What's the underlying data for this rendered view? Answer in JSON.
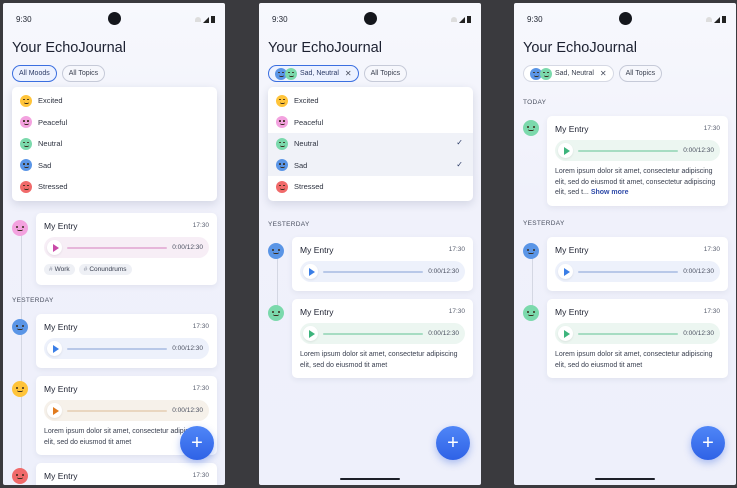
{
  "status_time": "9:30",
  "app_title": "Your EchoJournal",
  "filters": {
    "all_moods": "All Moods",
    "all_topics": "All Topics",
    "selected_moods": "Sad, Neutral",
    "clear_symbol": "✕"
  },
  "moods": [
    {
      "label": "Excited",
      "icon": "excited-face-icon",
      "color": "#ffc43a"
    },
    {
      "label": "Peaceful",
      "icon": "peaceful-face-icon",
      "color": "#f3a2df"
    },
    {
      "label": "Neutral",
      "icon": "neutral-face-icon",
      "color": "#7bd9ac"
    },
    {
      "label": "Sad",
      "icon": "sad-face-icon",
      "color": "#5a95e6"
    },
    {
      "label": "Stressed",
      "icon": "stressed-face-icon",
      "color": "#f06a6a"
    }
  ],
  "sections": {
    "today": "TODAY",
    "yesterday": "YESTERDAY"
  },
  "entry": {
    "title": "My Entry",
    "time": "17:30",
    "duration": "0:00/12:30",
    "text": "Lorem ipsum dolor sit amet, consectetur adipiscing elit, sed do eiusmod tit amet",
    "text_cut1": "Lorem ipsum dolor sit amet, consectetur adipiscing elit, sed do eiusmod tit amet",
    "text_cut3": "Lorem ipsum dolor sit amet, consectetur adipiscing elit, sed do eiusmod tit amet, consectetur adipiscing elit, sed t...",
    "show_more": "Show more"
  },
  "tags": [
    "Work",
    "Conundrums"
  ],
  "tag_prefix": "#",
  "fab_symbol": "+",
  "checkmark": "✓"
}
